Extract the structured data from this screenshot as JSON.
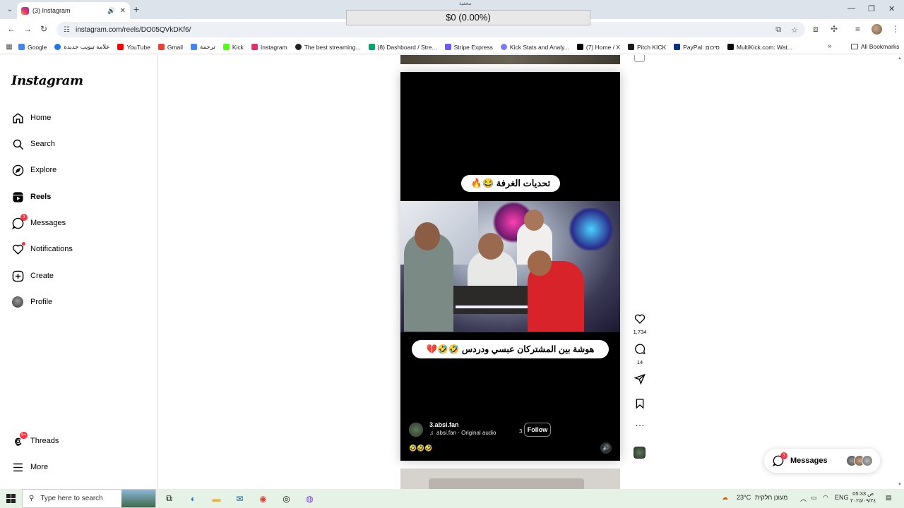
{
  "browser": {
    "tab_title": "(3) Instagram",
    "new_tab_label": "+",
    "top_caption": "مخفية",
    "url": "instagram.com/reels/DO05QVkDKf6/",
    "bookmarks": [
      {
        "label": "Google",
        "color": "#4285f4"
      },
      {
        "label": "علامة تبويب جديدة",
        "color": "#1877f2"
      },
      {
        "label": "YouTube",
        "color": "#ff0000"
      },
      {
        "label": "Gmail",
        "color": "#ea4335"
      },
      {
        "label": "ترجمة",
        "color": "#4285f4"
      },
      {
        "label": "Kick",
        "color": "#53fc18"
      },
      {
        "label": "Instagram",
        "color": "#e1306c"
      },
      {
        "label": "The best streaming...",
        "color": "#222222"
      },
      {
        "label": "(8) Dashboard / Stre...",
        "color": "#00a86b"
      },
      {
        "label": "Stripe Express",
        "color": "#635bff"
      },
      {
        "label": "Kick Stats and Analy...",
        "color": "#7a7aff"
      },
      {
        "label": "(7) Home / X",
        "color": "#000000"
      },
      {
        "label": "Pitch KICK",
        "color": "#1a1a1a"
      },
      {
        "label": "PayPal: סיכום",
        "color": "#003087"
      },
      {
        "label": "MultiKick.com: Wat...",
        "color": "#0a0a0a"
      }
    ],
    "all_bookmarks": "All Bookmarks"
  },
  "price_banner": "$0 (0.00%)",
  "sidebar": {
    "logo": "Instagram",
    "items": [
      {
        "label": "Home",
        "icon": "home-icon"
      },
      {
        "label": "Search",
        "icon": "search-icon"
      },
      {
        "label": "Explore",
        "icon": "explore-icon"
      },
      {
        "label": "Reels",
        "icon": "reels-icon"
      },
      {
        "label": "Messages",
        "icon": "messages-icon",
        "badge": "3"
      },
      {
        "label": "Notifications",
        "icon": "heart-icon"
      },
      {
        "label": "Create",
        "icon": "plus-icon"
      },
      {
        "label": "Profile",
        "icon": "avatar"
      },
      {
        "label": "Threads",
        "icon": "threads-icon",
        "badge": "9+"
      },
      {
        "label": "More",
        "icon": "menu-icon"
      }
    ]
  },
  "reel": {
    "caption_top": "تحديات الغرفة 😂🔥",
    "caption_bottom": "هوشة بين المشتركان عبسي ودردس 🤣🤣💔",
    "author": "3.absi.fan",
    "audio": "absi.fan · Original audio",
    "dot_separator": "3.",
    "follow_label": "Follow",
    "emoji_caption": "🤣🤣🤣",
    "likes": "1,734",
    "comments": "14"
  },
  "messages_pill": {
    "label": "Messages",
    "badge": "3"
  },
  "taskbar": {
    "search_placeholder": "Type here to search",
    "weather": "23°C",
    "weather_desc": "מעונן חלקית",
    "lang": "ENG",
    "time": "05:33 ص",
    "date": "٢٠٢٥/٠٩/٢٤"
  }
}
